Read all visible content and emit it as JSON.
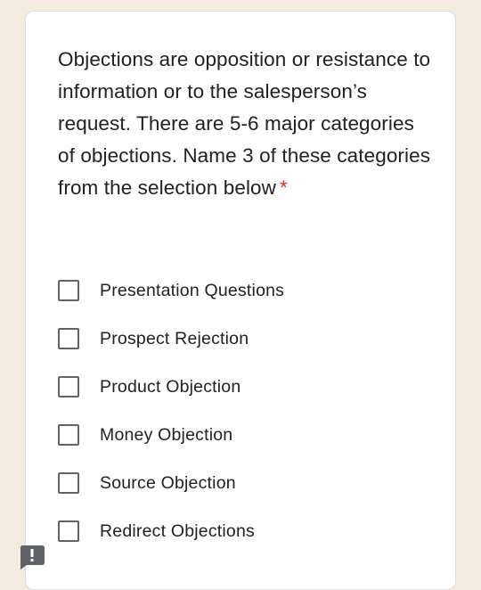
{
  "question": {
    "text": "Objections are opposition or resistance to information or to the salesperson’s request. There are 5-6 major categories of objections. Name 3 of these categories from the selection below",
    "required_marker": "*"
  },
  "options": [
    {
      "label": "Presentation Questions",
      "checked": false
    },
    {
      "label": "Prospect Rejection",
      "checked": false
    },
    {
      "label": "Product Objection",
      "checked": false
    },
    {
      "label": "Money Objection",
      "checked": false
    },
    {
      "label": "Source Objection",
      "checked": false
    },
    {
      "label": "Redirect Objections",
      "checked": false
    }
  ],
  "feedback_button": {
    "icon": "exclamation-feedback-icon"
  }
}
